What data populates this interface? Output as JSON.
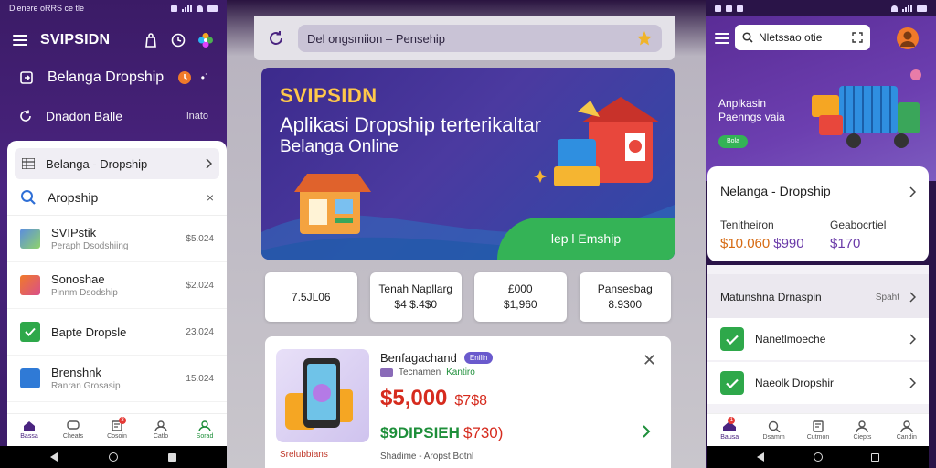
{
  "left_status": {
    "left_text": "Dienere oRRS ce tle",
    "icons": [
      "screenshot-icon",
      "signal-icon",
      "wifi-icon",
      "battery-icon"
    ]
  },
  "left_app": {
    "title": "SVIPSIDN",
    "header_icons": [
      "bag-icon",
      "timer-icon",
      "flower-logo-icon"
    ],
    "row1_label": "Belanga Dropship",
    "row2_label": "Dnadon Balle",
    "row2_right": "lnato",
    "selected_item": "Belanga - Dropship",
    "search_label": "Aropship",
    "items": [
      {
        "name": "SVIPstik",
        "sub": "Peraph Dsodshiing",
        "date": "$5.024",
        "thumb_color": "#5b8de0"
      },
      {
        "name": "Sonoshae",
        "sub": "Pinnm Dsodship",
        "date": "$2.024",
        "thumb_color": "#f07a2a"
      },
      {
        "name": "Bapte Dropsle",
        "sub": "",
        "date": "23.024",
        "thumb_color": "#2ea84a"
      },
      {
        "name": "Brenshnk",
        "sub": "Ranran Grosasip",
        "date": "15.024",
        "thumb_color": "#2f7ad6"
      }
    ],
    "bottom_nav": [
      "Bassa",
      "Cheats",
      "Cosoin",
      "Catlo",
      "Sorad"
    ],
    "bottom_badge": "3"
  },
  "middle": {
    "search_text": "Del ongsmiion – Pensehip",
    "hero_brand": "SVIPSIDN",
    "hero_title": "Aplikasi Dropship terterikaltar",
    "hero_sub": "Belanga Online",
    "hero_button": "lep l Emship",
    "stats": [
      {
        "line1": "7.5JL06",
        "line2": ""
      },
      {
        "line1": "Tenah Napllarg",
        "line2": "$4 $.4$0"
      },
      {
        "line1": "£000",
        "line2": "$1,960"
      },
      {
        "line1": "Pansesbag",
        "line2": "8.9300"
      }
    ],
    "product": {
      "name": "Benfagachand",
      "pill": "Enilin",
      "shop": "Tecnamen",
      "shop_tag": "Kantiro",
      "price": "$5,000",
      "price_old": "$7$8",
      "price2": "$9DIPSIEH",
      "price2_b": "$730)",
      "image_caption": "Srelubbians",
      "footer": "Shadime - Aropst Botnl"
    }
  },
  "right_status": {
    "icons": [
      "screenshot-icon",
      "bag-icon",
      "photo-icon",
      "wifi-icon",
      "signal-icon",
      "battery-icon"
    ]
  },
  "right_app": {
    "search_text": "Nletssao otie",
    "banner_line1": "Anplkasin",
    "banner_line2": "Paenngs vaia",
    "banner_button": "Bola",
    "card_title": "Nelanga - Dropship",
    "card_k1": "Tenitheiron",
    "card_k2": "Geabocrtiel",
    "card_v1": "$10.060",
    "card_v1b": "$990",
    "card_v2": "$170",
    "section_title": "Matunshna Drnaspin",
    "section_right": "Spaht",
    "items": [
      "Nanetlmoeche",
      "Naeolk Dropshir"
    ],
    "bottom_nav": [
      "Bausa",
      "Dsamm",
      "Cutmon",
      "Ciepts",
      "Candin"
    ],
    "bottom_badge": "1"
  }
}
